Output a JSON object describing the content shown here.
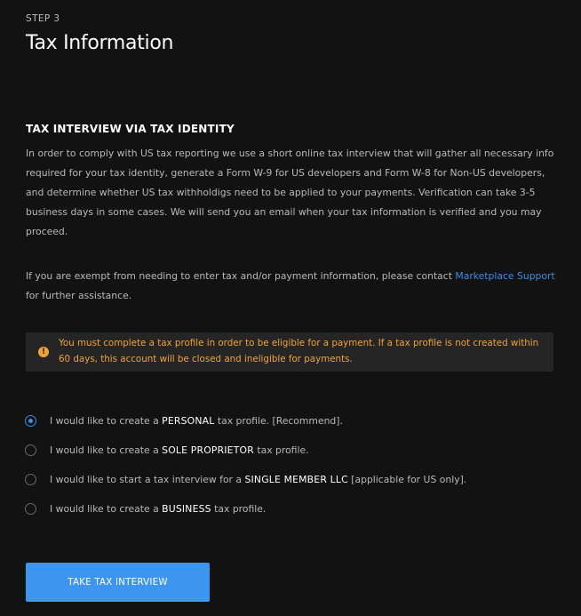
{
  "step_label": "STEP 3",
  "page_title": "Tax Information",
  "section_heading": "TAX INTERVIEW VIA TAX IDENTITY",
  "intro_paragraph": "In order to comply with US tax reporting we use a short online tax interview that will gather all necessary info required for your tax identity, generate a Form W-9 for US developers and Form W-8 for Non-US developers, and determine whether US tax withholdigs need to be applied to your payments. Verification can take 3-5 business days in some cases. We will send you an email when your tax information is verified and you may proceed.",
  "exempt_paragraph": {
    "before": "If you are exempt from needing to enter tax and/or payment information, please contact ",
    "link": "Marketplace Support",
    "after": " for further assistance."
  },
  "alert": {
    "icon": "warning-icon",
    "text": "You must complete a tax profile in order to be eligible for a payment. If a tax profile is not created within 60 days, this account will be closed and ineligible for payments."
  },
  "options": [
    {
      "before": "I would like to create a ",
      "emphasis": "PERSONAL",
      "after": " tax profile. [Recommend].",
      "selected": true
    },
    {
      "before": "I would like to create a ",
      "emphasis": "SOLE PROPRIETOR",
      "after": " tax profile.",
      "selected": false
    },
    {
      "before": "I would like to start a tax interview for a ",
      "emphasis": "SINGLE MEMBER LLC",
      "after": " [applicable for US only].",
      "selected": false
    },
    {
      "before": "I would like to create a ",
      "emphasis": "BUSINESS",
      "after": " tax profile.",
      "selected": false
    }
  ],
  "button_label": "TAKE TAX INTERVIEW",
  "colors": {
    "background": "#121212",
    "accent": "#3d95f0",
    "warning": "#f0a33a",
    "alert_background": "#252525"
  }
}
